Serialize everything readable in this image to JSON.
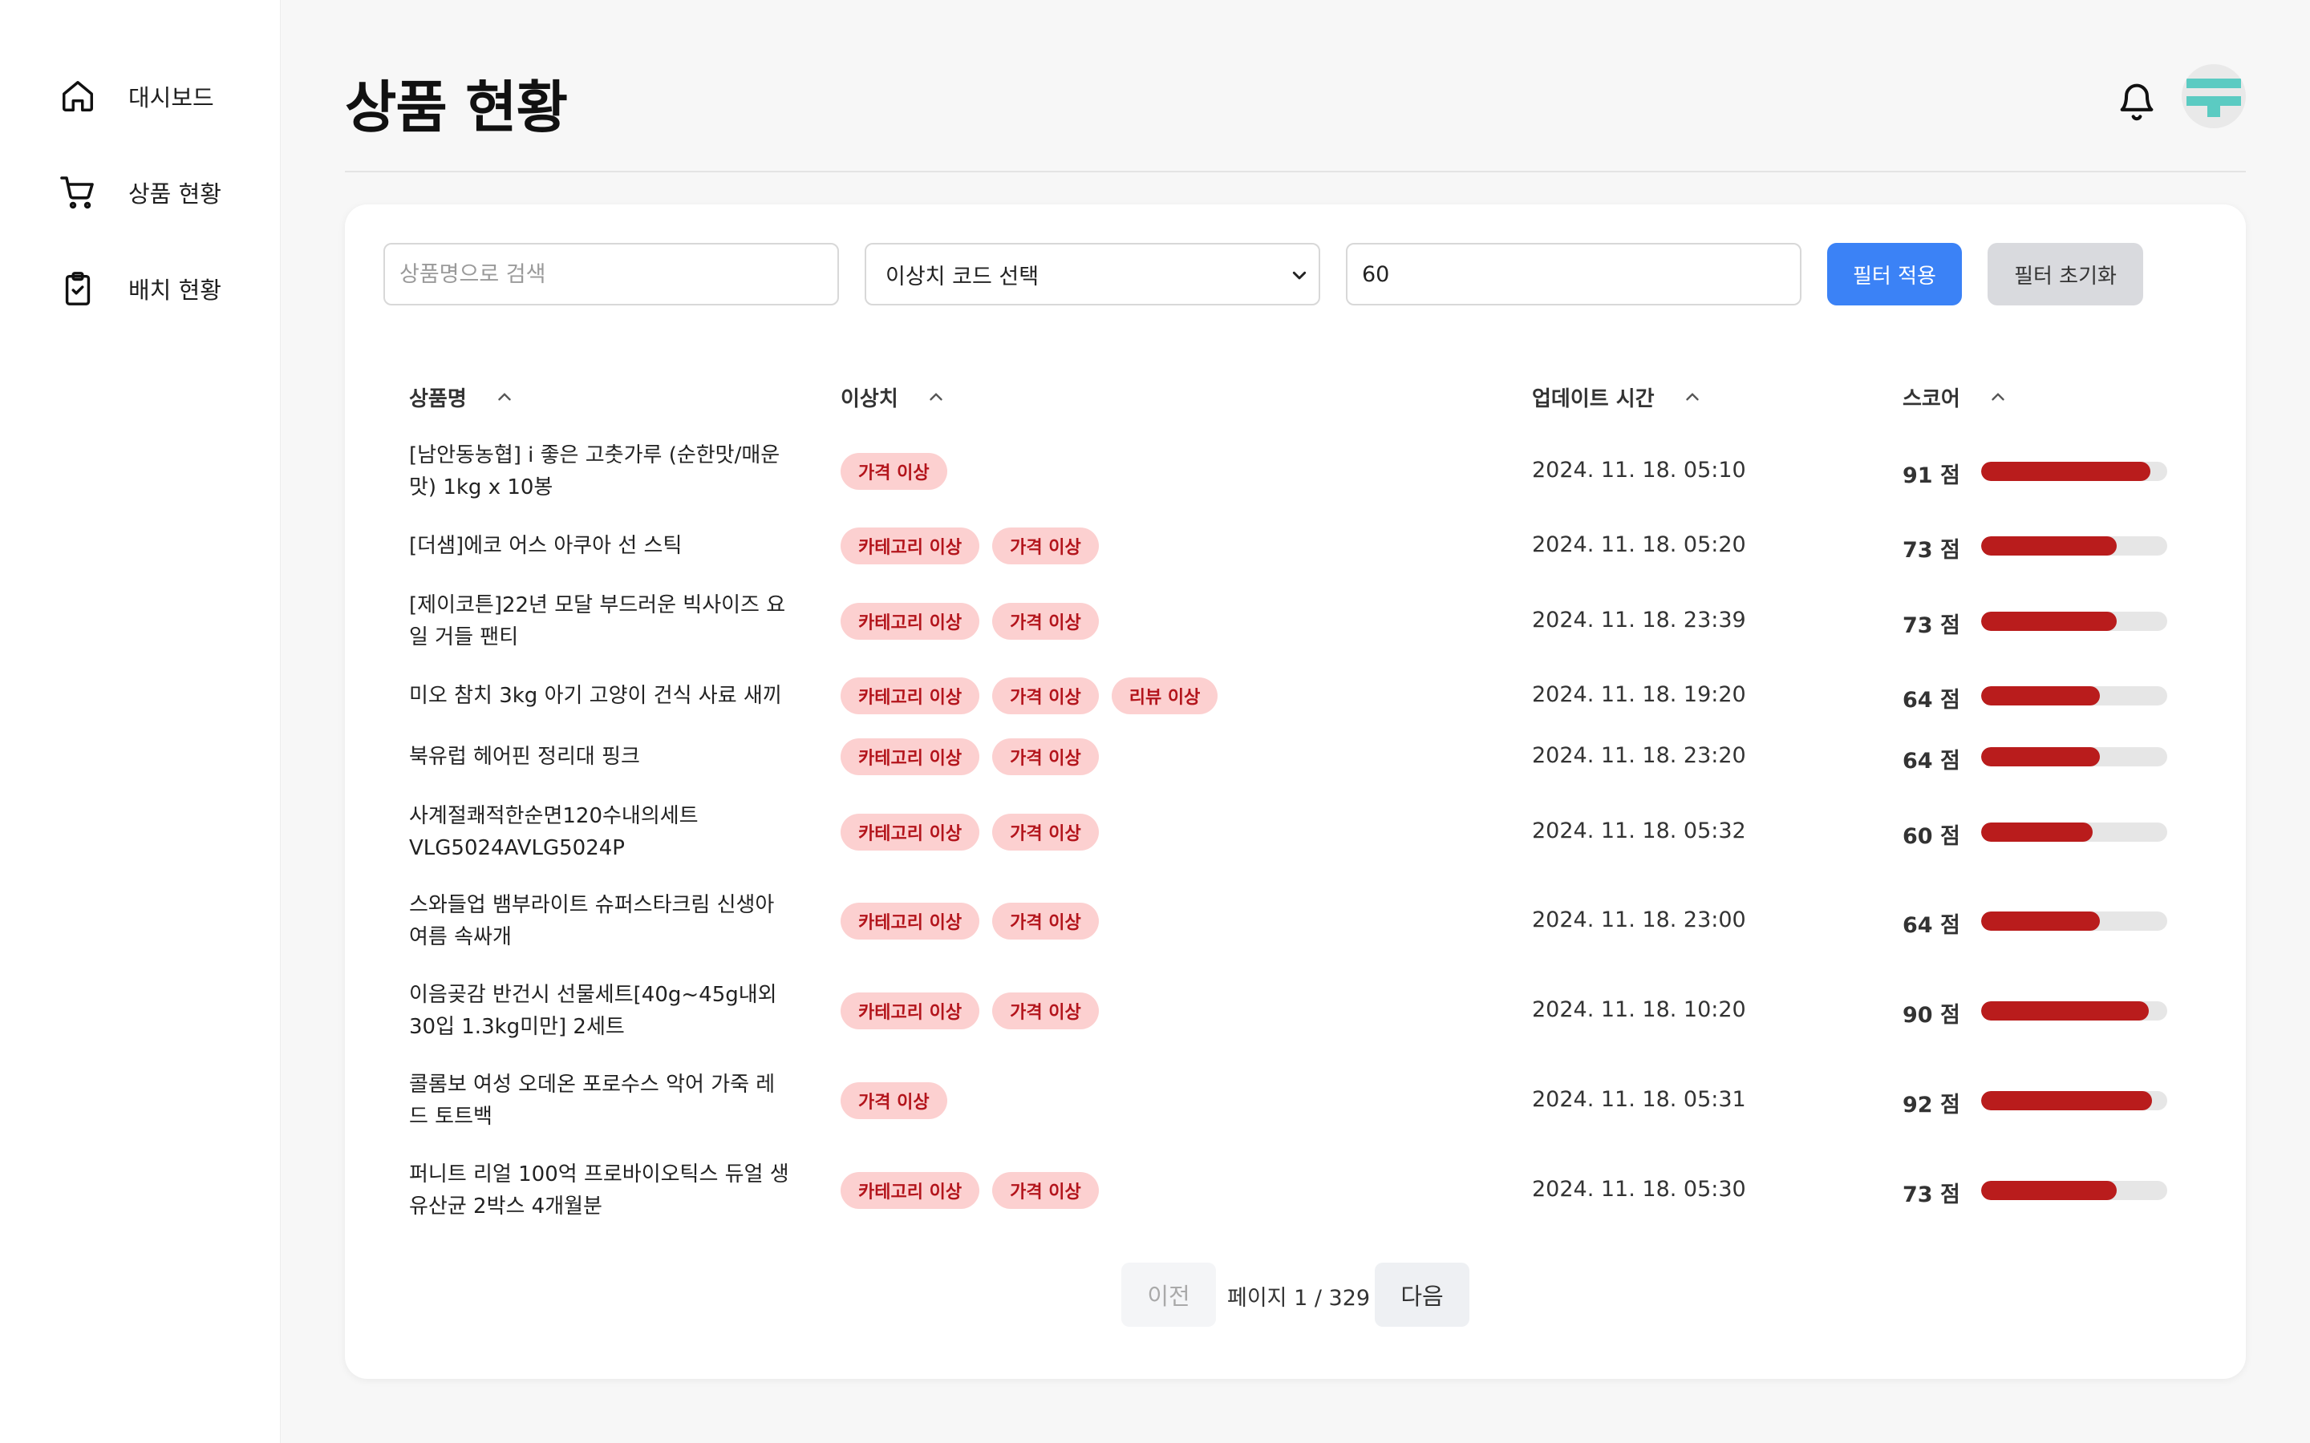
{
  "sidebar": {
    "items": [
      {
        "label": "대시보드",
        "icon": "home-icon"
      },
      {
        "label": "상품 현황",
        "icon": "cart-icon"
      },
      {
        "label": "배치 현황",
        "icon": "clipboard-check-icon"
      }
    ]
  },
  "header": {
    "title": "상품 현황"
  },
  "filters": {
    "search_placeholder": "상품명으로 검색",
    "select_value": "이상치 코드 선택",
    "threshold_value": "60",
    "apply_label": "필터 적용",
    "reset_label": "필터 초기화"
  },
  "table": {
    "headers": {
      "name": "상품명",
      "anomaly": "이상치",
      "updated": "업데이트 시간",
      "score": "스코어"
    },
    "rows": [
      {
        "name": "[남안동농협] i 좋은 고춧가루 (순한맛/매운맛) 1kg x 10봉",
        "tags": [
          "가격 이상"
        ],
        "time": "2024. 11. 18. 05:10",
        "score_text": "91 점",
        "score": 91
      },
      {
        "name": "[더샘]에코 어스 아쿠아 선 스틱",
        "tags": [
          "카테고리 이상",
          "가격 이상"
        ],
        "time": "2024. 11. 18. 05:20",
        "score_text": "73 점",
        "score": 73
      },
      {
        "name": "[제이코튼]22년 모달 부드러운 빅사이즈 요일 거들 팬티",
        "tags": [
          "카테고리 이상",
          "가격 이상"
        ],
        "time": "2024. 11. 18. 23:39",
        "score_text": "73 점",
        "score": 73
      },
      {
        "name": "미오 참치 3kg 아기 고양이 건식 사료 새끼",
        "tags": [
          "카테고리 이상",
          "가격 이상",
          "리뷰 이상"
        ],
        "time": "2024. 11. 18. 19:20",
        "score_text": "64 점",
        "score": 64
      },
      {
        "name": "북유럽 헤어핀 정리대 핑크",
        "tags": [
          "카테고리 이상",
          "가격 이상"
        ],
        "time": "2024. 11. 18. 23:20",
        "score_text": "64 점",
        "score": 64
      },
      {
        "name": "사계절쾌적한순면120수내의세트 VLG5024AVLG5024P",
        "tags": [
          "카테고리 이상",
          "가격 이상"
        ],
        "time": "2024. 11. 18. 05:32",
        "score_text": "60 점",
        "score": 60
      },
      {
        "name": "스와들업 뱀부라이트 슈퍼스타크림 신생아 여름 속싸개",
        "tags": [
          "카테고리 이상",
          "가격 이상"
        ],
        "time": "2024. 11. 18. 23:00",
        "score_text": "64 점",
        "score": 64
      },
      {
        "name": "이음곶감 반건시 선물세트[40g~45g내외 30입 1.3kg미만] 2세트",
        "tags": [
          "카테고리 이상",
          "가격 이상"
        ],
        "time": "2024. 11. 18. 10:20",
        "score_text": "90 점",
        "score": 90
      },
      {
        "name": "콜롬보 여성 오데온 포로수스 악어 가죽 레드 토트백",
        "tags": [
          "가격 이상"
        ],
        "time": "2024. 11. 18. 05:31",
        "score_text": "92 점",
        "score": 92
      },
      {
        "name": "퍼니트 리얼 100억 프로바이오틱스 듀얼 생유산균 2박스 4개월분",
        "tags": [
          "카테고리 이상",
          "가격 이상"
        ],
        "time": "2024. 11. 18. 05:30",
        "score_text": "73 점",
        "score": 73
      }
    ]
  },
  "pagination": {
    "prev_label": "이전",
    "info": "페이지 1 / 329",
    "next_label": "다음"
  },
  "colors": {
    "accent": "#3b82f6",
    "tag_bg": "#fcd0d0",
    "tag_text": "#b3141b",
    "bar_fill": "#b91c1c",
    "avatar": "#5bcbc2"
  }
}
